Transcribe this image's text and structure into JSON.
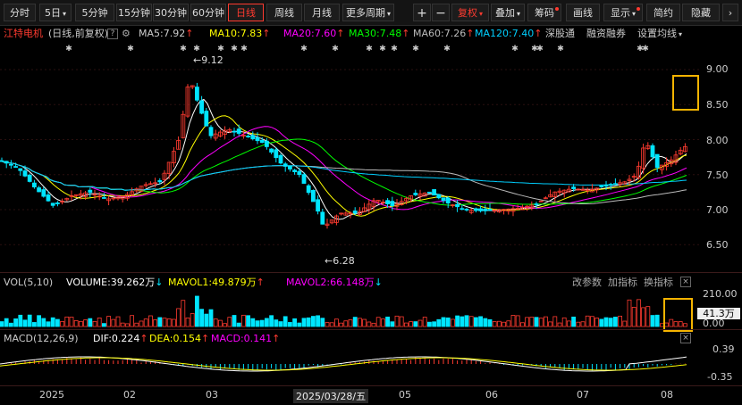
{
  "toolbar": {
    "periods": [
      "分时",
      "5日",
      "5分钟",
      "15分钟",
      "30分钟",
      "60分钟",
      "日线",
      "周线",
      "月线",
      "更多周期"
    ],
    "active_period": "日线",
    "more_arrow": "▾",
    "plus": "+",
    "minus": "−",
    "fuquan": "复权",
    "overlay": "叠加",
    "chips": "筹码",
    "draw": "画线",
    "display": "显示",
    "simple": "简约",
    "hide": "隐藏"
  },
  "info": {
    "stock_name": "江特电机",
    "mode": "(日线,前复权)",
    "ma5": "MA5:7.92",
    "ma10": "MA10:7.83",
    "ma20": "MA20:7.60",
    "ma30": "MA30:7.48",
    "ma60": "MA60:7.26",
    "ma120": "MA120:7.40",
    "up_arrow": "↑",
    "link1": "深股通",
    "link2": "融资融券",
    "link3": "设置均线"
  },
  "price_axis": [
    "9.00",
    "8.50",
    "8.00",
    "7.50",
    "7.00",
    "6.50"
  ],
  "annotations": {
    "high": "9.12",
    "low": "6.28"
  },
  "volume": {
    "name": "VOL(5,10)",
    "volume": "VOLUME:39.262万",
    "vol_arrow": "↓",
    "mavol1": "MAVOL1:49.879万",
    "mavol1_arrow": "↑",
    "mavol2": "MAVOL2:66.148万",
    "mavol2_arrow": "↓",
    "change_params": "改参数",
    "add_indicator": "加指标",
    "switch_indicator": "换指标",
    "axis": [
      "210.00",
      "0.00"
    ],
    "unit": "万",
    "current_badge": "41.3万"
  },
  "macd": {
    "name": "MACD(12,26,9)",
    "dif": "DIF:0.224",
    "dif_arrow": "↑",
    "dea": "DEA:0.154",
    "dea_arrow": "↑",
    "macd": "MACD:0.141",
    "macd_arrow": "↑",
    "axis": [
      "0.39",
      "-0.35"
    ]
  },
  "date_axis": [
    "2025",
    "02",
    "03",
    "2025/03/28/五",
    "05",
    "06",
    "07",
    "08"
  ],
  "colors": {
    "up": "#ff3b30",
    "down": "#00e5ff",
    "ma5": "#ffffff",
    "ma10": "#ffff00",
    "ma20": "#ff00ff",
    "ma30": "#00ff00",
    "ma60": "#bbbbbb",
    "ma120": "#00cfff",
    "highlight": "#f5b400"
  }
}
